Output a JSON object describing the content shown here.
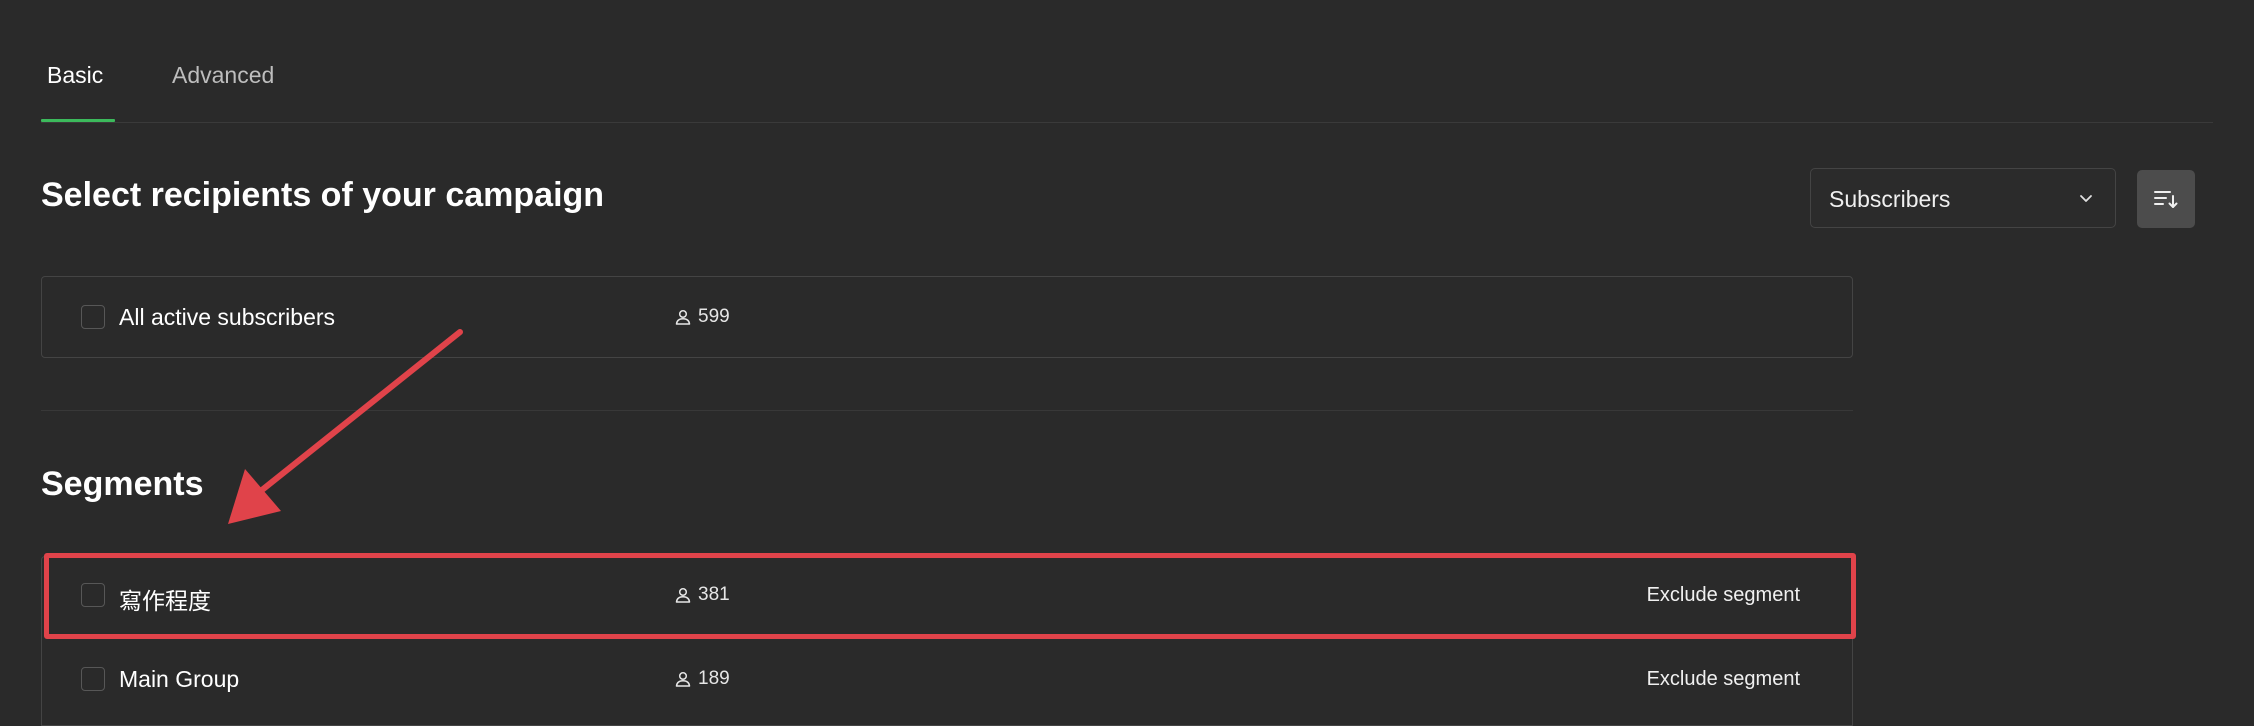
{
  "tabs": [
    {
      "label": "Basic",
      "active": true
    },
    {
      "label": "Advanced",
      "active": false
    }
  ],
  "header": {
    "title": "Select recipients of your campaign",
    "dropdown_value": "Subscribers"
  },
  "all_subscribers": {
    "label": "All active subscribers",
    "count": "599",
    "checked": false
  },
  "segments": {
    "title": "Segments",
    "items": [
      {
        "label": "寫作程度",
        "count": "381",
        "action": "Exclude segment",
        "checked": false
      },
      {
        "label": "Main Group",
        "count": "189",
        "action": "Exclude segment",
        "checked": false
      }
    ]
  },
  "colors": {
    "background": "#2a2a2a",
    "accent": "#3cba5c",
    "annotation": "#e0434a",
    "border": "#444444"
  },
  "icons": {
    "person": "person-icon",
    "chevron": "chevron-down-icon",
    "sort": "sort-icon"
  }
}
